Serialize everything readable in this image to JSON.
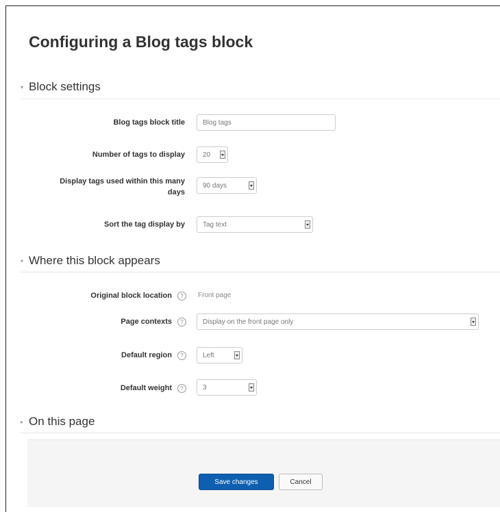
{
  "page": {
    "title": "Configuring a Blog tags block"
  },
  "sections": {
    "block_settings": {
      "label": "Block settings",
      "toggle": "▾"
    },
    "where": {
      "label": "Where this block appears",
      "toggle": "▾"
    },
    "on_this_page": {
      "label": "On this page",
      "toggle": "▸"
    }
  },
  "fields": {
    "title": {
      "label": "Blog tags block title",
      "value": "Blog tags"
    },
    "num_tags": {
      "label": "Number of tags to display",
      "value": "20"
    },
    "days": {
      "label_line1": "Display tags used within this many",
      "label_line2": "days",
      "value": "90 days"
    },
    "sort": {
      "label": "Sort the tag display by",
      "value": "Tag text"
    },
    "original_location": {
      "label": "Original block location",
      "value": "Front page"
    },
    "page_contexts": {
      "label": "Page contexts",
      "value": "Display on the front page only"
    },
    "default_region": {
      "label": "Default region",
      "value": "Left"
    },
    "default_weight": {
      "label": "Default weight",
      "value": "3"
    }
  },
  "buttons": {
    "save": "Save changes",
    "cancel": "Cancel"
  },
  "help_glyph": "?",
  "colors": {
    "primary": "#0f5fb0"
  }
}
